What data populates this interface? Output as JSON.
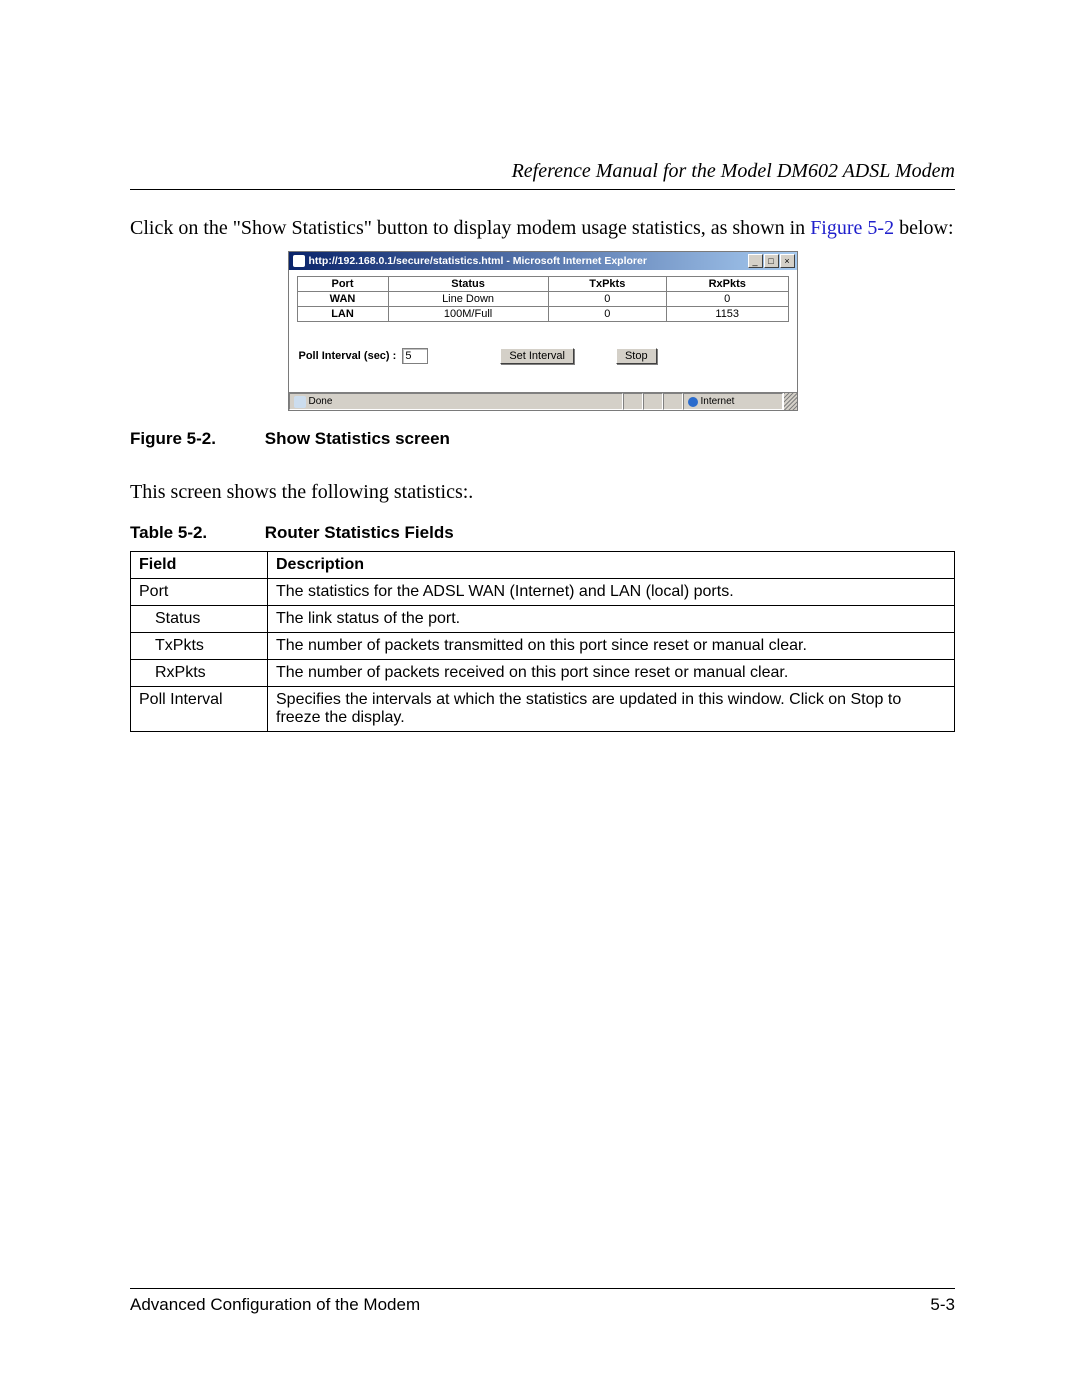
{
  "header_title": "Reference Manual for the Model DM602 ADSL Modem",
  "intro_text_pre": "Click on the \"Show Statistics\" button to display modem usage statistics, as shown in ",
  "intro_link": "Figure 5-2",
  "intro_text_post": " below:",
  "window": {
    "title": "http://192.168.0.1/secure/statistics.html - Microsoft Internet Explorer",
    "headers": [
      "Port",
      "Status",
      "TxPkts",
      "RxPkts"
    ],
    "rows": [
      {
        "port": "WAN",
        "status": "Line Down",
        "tx": "0",
        "rx": "0"
      },
      {
        "port": "LAN",
        "status": "100M/Full",
        "tx": "0",
        "rx": "1153"
      }
    ],
    "poll_label": "Poll Interval (sec) :",
    "poll_value": "5",
    "set_interval": "Set Interval",
    "stop": "Stop",
    "status_done": "Done",
    "status_internet": "Internet",
    "minimize": "_",
    "maximize": "□",
    "close": "×"
  },
  "figure_caption_label": "Figure 5-2.",
  "figure_caption_text": "Show Statistics screen",
  "mid_text": "This screen shows the following statistics:.",
  "table_caption_label": "Table 5-2.",
  "table_caption_text": "Router Statistics Fields",
  "desc_headers": {
    "field": "Field",
    "description": "Description"
  },
  "desc_rows": [
    {
      "field": "Port",
      "indent": false,
      "desc": "The statistics for the ADSL WAN (Internet) and LAN (local) ports."
    },
    {
      "field": "Status",
      "indent": true,
      "desc": "The link status of the port."
    },
    {
      "field": "TxPkts",
      "indent": true,
      "desc": "The number of packets transmitted on this port since reset or manual clear."
    },
    {
      "field": "RxPkts",
      "indent": true,
      "desc": "The number of packets received on this port since reset or manual clear."
    },
    {
      "field": "Poll Interval",
      "indent": false,
      "desc": "Specifies the intervals at which the statistics are updated in this window. Click on Stop to freeze the display."
    }
  ],
  "footer_left": "Advanced Configuration of the Modem",
  "footer_right": "5-3"
}
